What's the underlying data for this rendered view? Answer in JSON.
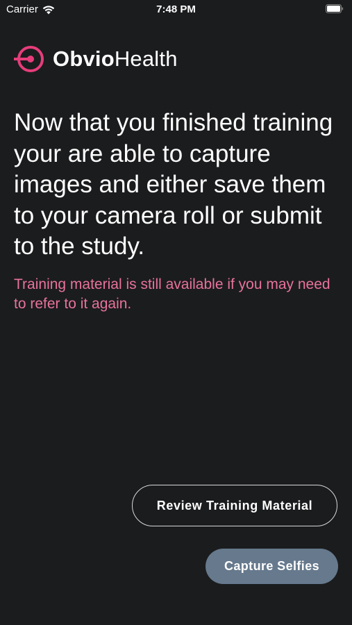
{
  "status_bar": {
    "carrier": "Carrier",
    "time": "7:48 PM",
    "wifi_icon": "wifi-icon",
    "battery_icon": "battery-icon"
  },
  "logo": {
    "icon": "obvio-target-icon",
    "text_bold": "Obvio",
    "text_light": "Health",
    "accent_color": "#e63d7a"
  },
  "main": {
    "headline": "Now that you finished training your are able to capture images and either save them to your camera roll or submit to the study.",
    "note": "Training material is still available if you may need to refer to it again.",
    "note_color": "#e8739a"
  },
  "buttons": {
    "review_label": "Review Training Material",
    "capture_label": "Capture Selfies",
    "capture_color": "#66798d"
  }
}
